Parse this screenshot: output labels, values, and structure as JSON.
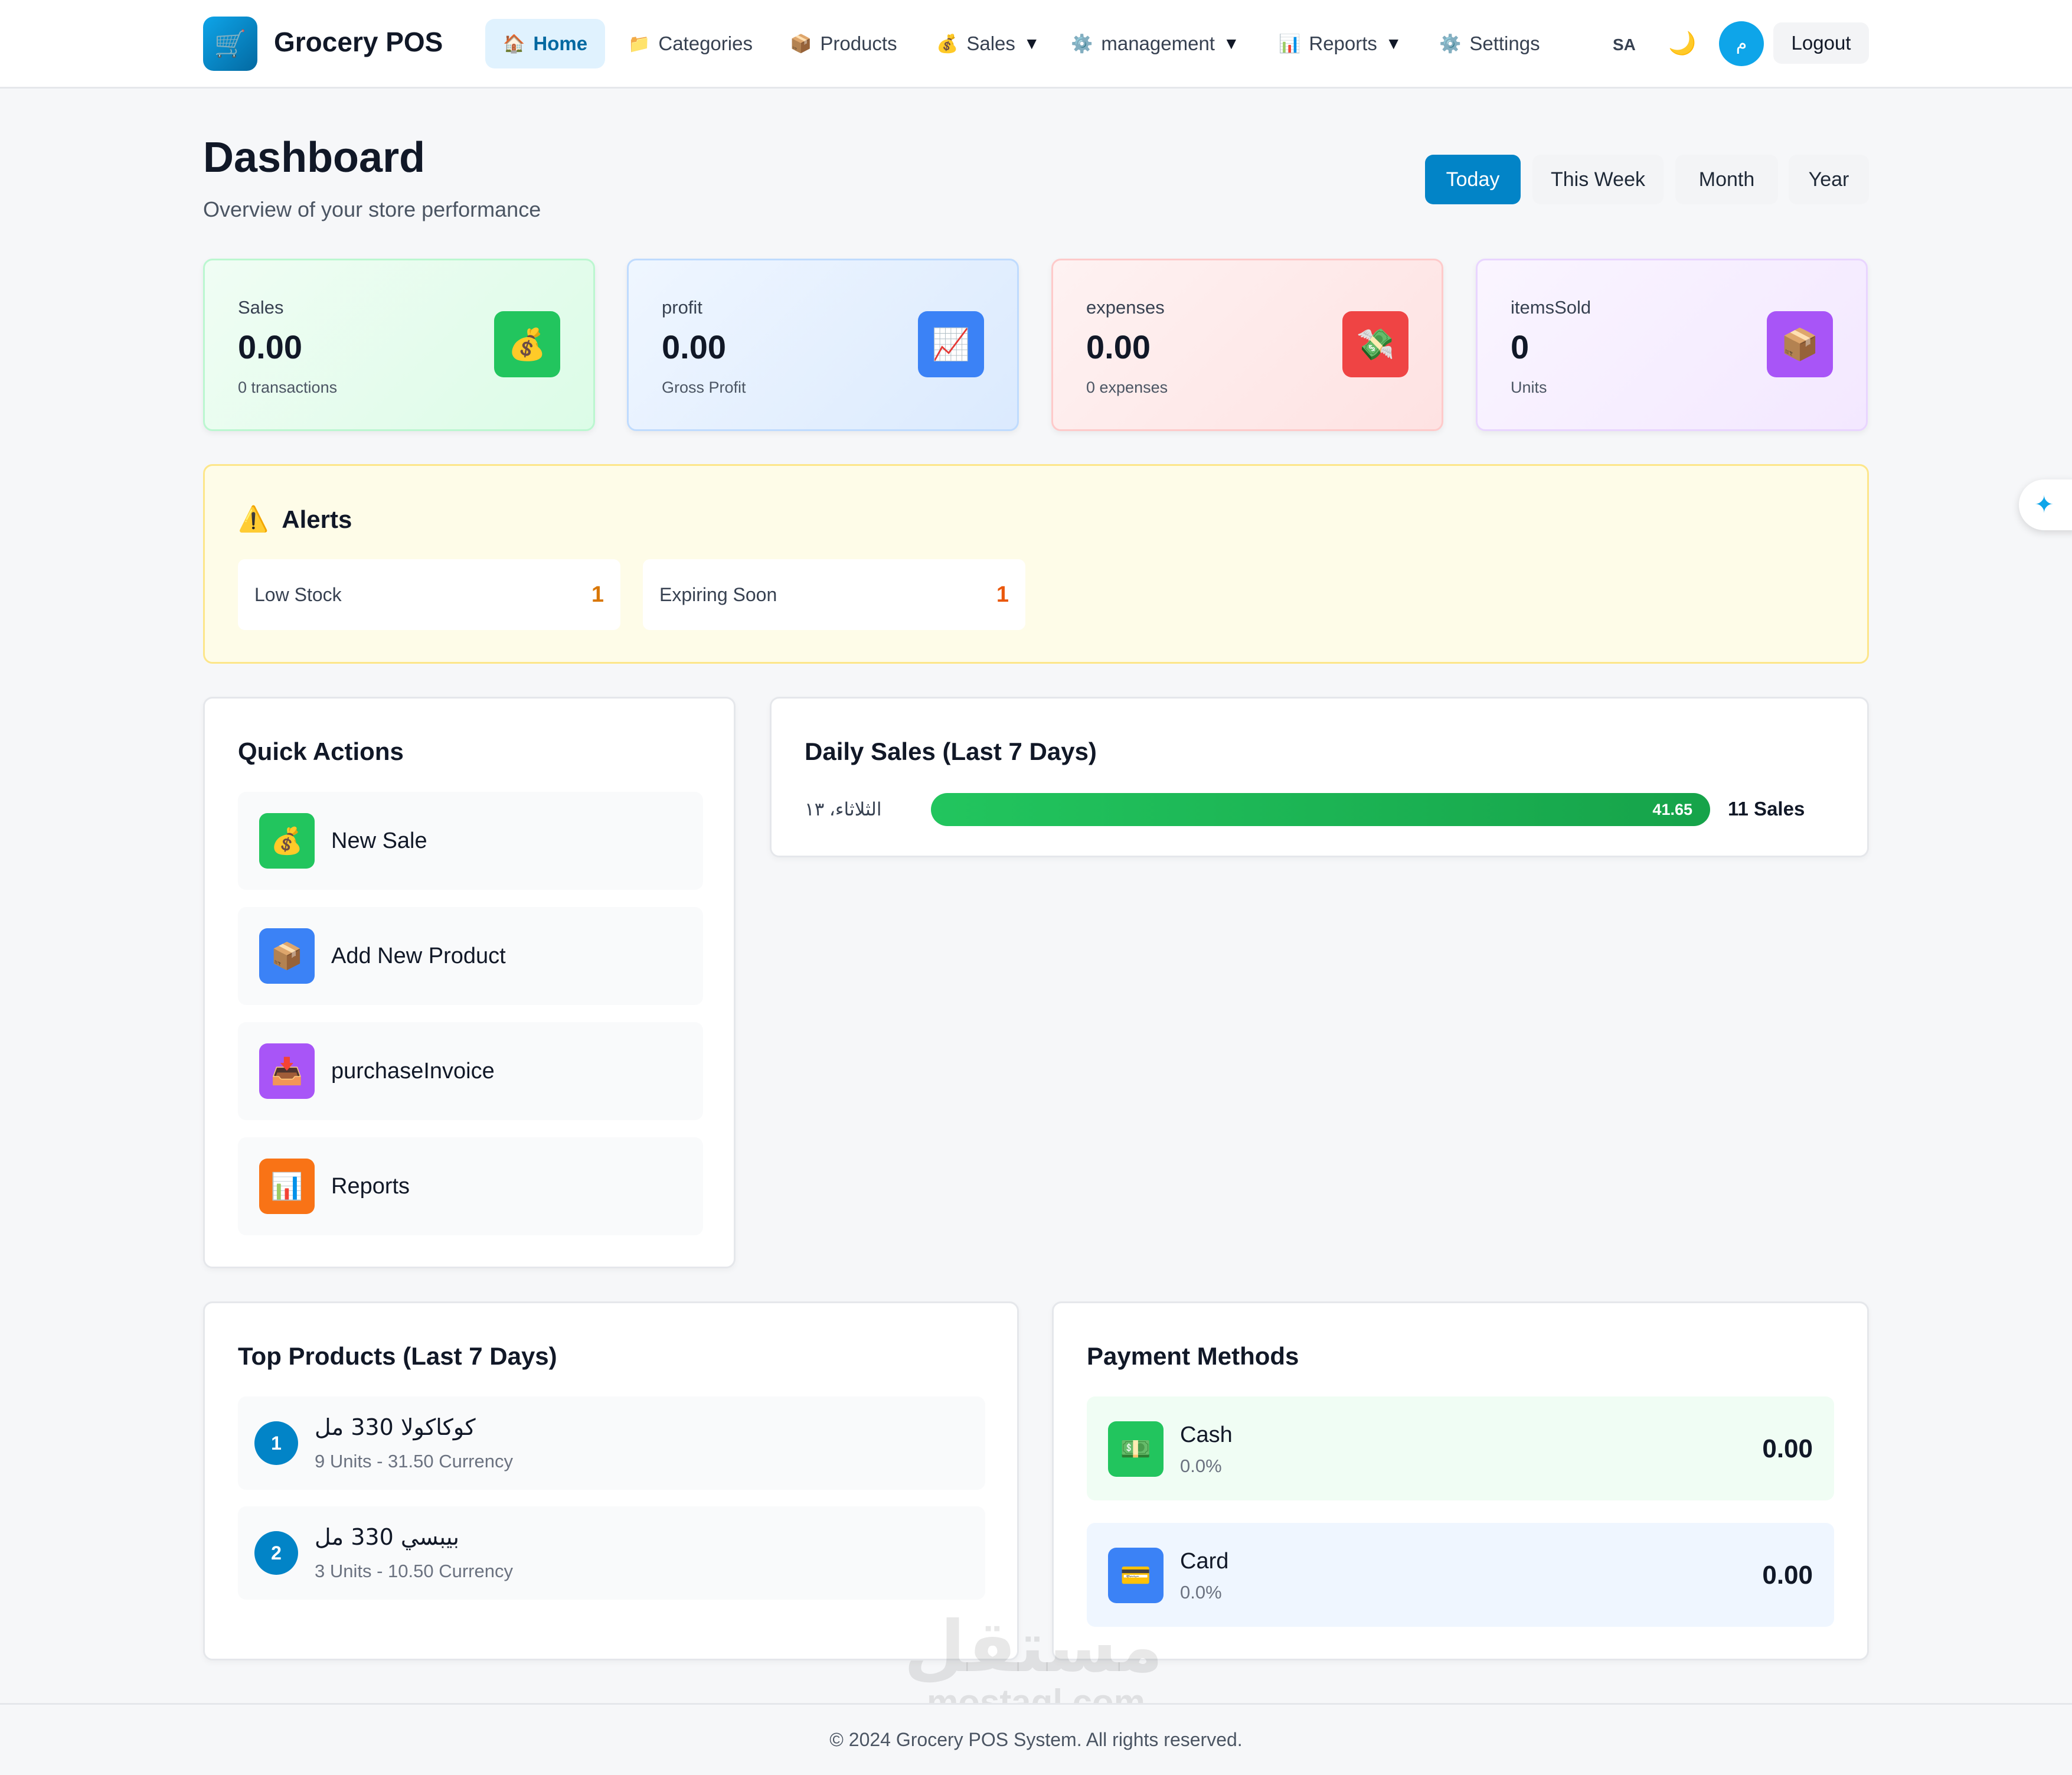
{
  "app": {
    "name": "Grocery POS",
    "logo_icon": "cash-register-icon"
  },
  "nav": {
    "items": [
      {
        "label": "Home",
        "icon": "🏠"
      },
      {
        "label": "Categories",
        "icon": "📁"
      },
      {
        "label": "Products",
        "icon": "📦"
      },
      {
        "label": "Sales",
        "icon": "💰",
        "caret": "▼"
      },
      {
        "label": "management",
        "icon": "⚙️",
        "caret": "▼"
      },
      {
        "label": "Reports",
        "icon": "📊",
        "caret": "▼"
      },
      {
        "label": "Settings",
        "icon": "⚙️"
      }
    ],
    "language": "SA",
    "theme_icon": "🌙",
    "avatar_initial": "م",
    "logout": "Logout"
  },
  "header": {
    "title": "Dashboard",
    "subtitle": "Overview of your store performance",
    "ranges": [
      "Today",
      "This Week",
      "Month",
      "Year"
    ],
    "active_range": "Today"
  },
  "stats": [
    {
      "label": "Sales",
      "value": "0.00",
      "sub": "0 transactions",
      "icon": "💰",
      "icon_bg": "#22c55e"
    },
    {
      "label": "profit",
      "value": "0.00",
      "sub": "Gross Profit",
      "icon": "📈",
      "icon_bg": "#3b82f6"
    },
    {
      "label": "expenses",
      "value": "0.00",
      "sub": "0 expenses",
      "icon": "💸",
      "icon_bg": "#ef4444"
    },
    {
      "label": "itemsSold",
      "value": "0",
      "sub": "Units",
      "icon": "📦",
      "icon_bg": "#a855f7"
    }
  ],
  "alerts": {
    "title": "Alerts",
    "icon": "⚠️",
    "items": [
      {
        "label": "Low Stock",
        "count": "1",
        "color": "#d97706"
      },
      {
        "label": "Expiring Soon",
        "count": "1",
        "color": "#ea580c"
      }
    ]
  },
  "quick_actions": {
    "title": "Quick Actions",
    "items": [
      {
        "label": "New Sale",
        "icon": "💰",
        "bg": "#22c55e"
      },
      {
        "label": "Add New Product",
        "icon": "📦",
        "bg": "#3b82f6"
      },
      {
        "label": "purchaseInvoice",
        "icon": "📥",
        "bg": "#a855f7"
      },
      {
        "label": "Reports",
        "icon": "📊",
        "bg": "#f97316"
      }
    ]
  },
  "daily_sales": {
    "title": "Daily Sales (Last 7 Days)",
    "rows": [
      {
        "day": "الثلاثاء، ١٣",
        "amount": "41.65",
        "fill": 1.0,
        "count": "11 Sales"
      }
    ]
  },
  "top_products": {
    "title": "Top Products (Last 7 Days)",
    "items": [
      {
        "rank": "1",
        "name": "كوكاكولا 330 مل",
        "meta": "9 Units - 31.50 Currency"
      },
      {
        "rank": "2",
        "name": "بيبسي 330 مل",
        "meta": "3 Units - 10.50 Currency"
      }
    ]
  },
  "payment_methods": {
    "title": "Payment Methods",
    "items": [
      {
        "label": "Cash",
        "pct": "0.0%",
        "amount": "0.00",
        "icon": "💵",
        "icon_bg": "#22c55e",
        "bg": "#f0fdf4"
      },
      {
        "label": "Card",
        "pct": "0.0%",
        "amount": "0.00",
        "icon": "💳",
        "icon_bg": "#3b82f6",
        "bg": "#eff6ff"
      }
    ]
  },
  "floating_button_icon": "sparkle-drop-icon",
  "watermark": {
    "arabic": "مستقل",
    "latin": "mostaql.com"
  },
  "footer": "© 2024 Grocery POS System. All rights reserved."
}
